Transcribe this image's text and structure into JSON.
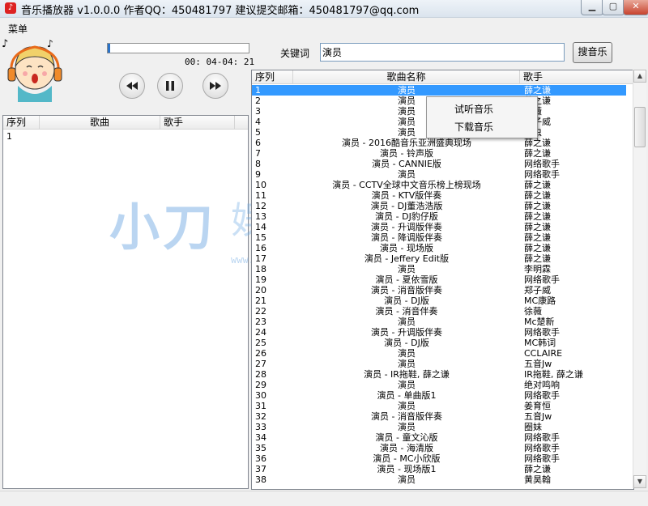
{
  "window": {
    "title": "音乐播放器 v1.0.0.0   作者QQ：450481797 建议提交邮箱：450481797@qq.com",
    "app_icon": "music-app-icon"
  },
  "menu": {
    "label": "菜单"
  },
  "player": {
    "progress": 0.02,
    "time": "00: 04-04: 21",
    "prev_icon": "rewind-icon",
    "pause_icon": "pause-icon",
    "next_icon": "fast-forward-icon",
    "accent": "#2a72c8"
  },
  "search": {
    "label": "关键词",
    "value": "演员",
    "button": "搜音乐"
  },
  "playlist": {
    "headers": {
      "index": "序列",
      "song": "歌曲",
      "singer": "歌手"
    },
    "rows": [
      {
        "index": "1"
      }
    ]
  },
  "results": {
    "headers": {
      "index": "序列",
      "name": "歌曲名称",
      "singer": "歌手"
    },
    "selected_index": 0,
    "rows": [
      {
        "index": "1",
        "name": "演员",
        "singer": "薛之谦"
      },
      {
        "index": "2",
        "name": "演员",
        "singer": "薛之谦"
      },
      {
        "index": "3",
        "name": "演员",
        "singer": "徐薇"
      },
      {
        "index": "4",
        "name": "演员",
        "singer": "郑子威"
      },
      {
        "index": "5",
        "name": "演员",
        "singer": "虫虫"
      },
      {
        "index": "6",
        "name": "演员 - 2016酷音乐亚洲盛典现场",
        "singer": "薛之谦"
      },
      {
        "index": "7",
        "name": "演员 - 铃声版",
        "singer": "薛之谦"
      },
      {
        "index": "8",
        "name": "演员 - CANNIE版",
        "singer": "网络歌手"
      },
      {
        "index": "9",
        "name": "演员",
        "singer": "网络歌手"
      },
      {
        "index": "10",
        "name": "演员 - CCTV全球中文音乐榜上榜现场",
        "singer": "薛之谦"
      },
      {
        "index": "11",
        "name": "演员 - KTV版伴奏",
        "singer": "薛之谦"
      },
      {
        "index": "12",
        "name": "演员 - DJ董浩浩版",
        "singer": "薛之谦"
      },
      {
        "index": "13",
        "name": "演员 - DJ豹仔版",
        "singer": "薛之谦"
      },
      {
        "index": "14",
        "name": "演员 - 升调版伴奏",
        "singer": "薛之谦"
      },
      {
        "index": "15",
        "name": "演员 - 降调版伴奏",
        "singer": "薛之谦"
      },
      {
        "index": "16",
        "name": "演员 - 现场版",
        "singer": "薛之谦"
      },
      {
        "index": "17",
        "name": "演员 - Jeffery Edit版",
        "singer": "薛之谦"
      },
      {
        "index": "18",
        "name": "演员",
        "singer": "李明霖"
      },
      {
        "index": "19",
        "name": "演员 - 夏依雪版",
        "singer": "网络歌手"
      },
      {
        "index": "20",
        "name": "演员 - 消音版伴奏",
        "singer": "郑子威"
      },
      {
        "index": "21",
        "name": "演员 - DJ版",
        "singer": "MC康路"
      },
      {
        "index": "22",
        "name": "演员 - 消音伴奏",
        "singer": "徐薇"
      },
      {
        "index": "23",
        "name": "演员",
        "singer": "Mc楚新"
      },
      {
        "index": "24",
        "name": "演员 - 升调版伴奏",
        "singer": "网络歌手"
      },
      {
        "index": "25",
        "name": "演员 - DJ版",
        "singer": "MC韩词"
      },
      {
        "index": "26",
        "name": "演员",
        "singer": "CCLAIRE"
      },
      {
        "index": "27",
        "name": "演员",
        "singer": "五音Jw"
      },
      {
        "index": "28",
        "name": "演员 - IR拖鞋, 薛之谦",
        "singer": "IR拖鞋, 薛之谦"
      },
      {
        "index": "29",
        "name": "演员",
        "singer": "绝对鸣响"
      },
      {
        "index": "30",
        "name": "演员 - 单曲版1",
        "singer": "网络歌手"
      },
      {
        "index": "31",
        "name": "演员",
        "singer": "姜育恒"
      },
      {
        "index": "32",
        "name": "演员 - 消音版伴奏",
        "singer": "五音Jw"
      },
      {
        "index": "33",
        "name": "演员",
        "singer": "圈妹"
      },
      {
        "index": "34",
        "name": "演员 - 童文沁版",
        "singer": "网络歌手"
      },
      {
        "index": "35",
        "name": "演员 - 海清版",
        "singer": "网络歌手"
      },
      {
        "index": "36",
        "name": "演员 - MC小欣版",
        "singer": "网络歌手"
      },
      {
        "index": "37",
        "name": "演员 - 现场版1",
        "singer": "薛之谦"
      },
      {
        "index": "38",
        "name": "演员",
        "singer": "黄昊翰"
      }
    ]
  },
  "context_menu": {
    "items": [
      "试听音乐",
      "下载音乐"
    ]
  },
  "watermark": {
    "main": "小刀",
    "sub": "娱乐网",
    "url": "www.xiaodao.la"
  }
}
